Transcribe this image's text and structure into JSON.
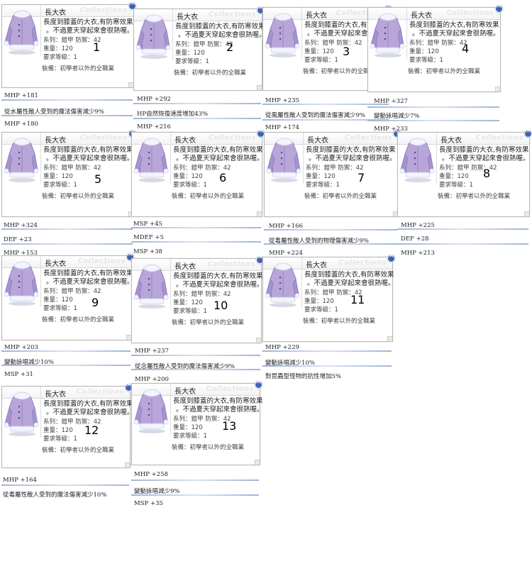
{
  "card_common": {
    "title": "長大衣",
    "watermark": "Collections",
    "desc_line1": "長度到膝蓋的大衣,有防寒效果",
    "desc_line2": "。不過夏天穿起來會很熱喔。",
    "series_line": "系列：鎧甲  防禦：42",
    "weight_line": "重量：120",
    "level_line": "要求等級：1",
    "equip_line": "裝備：初學者以外的全職業",
    "close_icon": "close-icon",
    "portrait_icon": "coat-icon"
  },
  "cards": [
    {
      "number": "1"
    },
    {
      "number": "2"
    },
    {
      "number": "3"
    },
    {
      "number": "4"
    },
    {
      "number": "5"
    },
    {
      "number": "6"
    },
    {
      "number": "7"
    },
    {
      "number": "8"
    },
    {
      "number": "9"
    },
    {
      "number": "10"
    },
    {
      "number": "11"
    },
    {
      "number": "12"
    },
    {
      "number": "13"
    }
  ],
  "bonuses": [
    {
      "text": "MHP +181"
    },
    {
      "text": "從水屬性敵人受到的魔法傷害減少9%"
    },
    {
      "text": "MHP +180"
    },
    {
      "text": "MHP +292"
    },
    {
      "text": "HP自然恢復速度增加43%"
    },
    {
      "text": "MHP +216"
    },
    {
      "text": "MHP +235"
    },
    {
      "text": "從風屬性敵人受到的魔法傷害減少9%"
    },
    {
      "text": "MHP +174"
    },
    {
      "text": "MHP +327"
    },
    {
      "text": "變動詠唱減少7%"
    },
    {
      "text": "MHP +233"
    },
    {
      "text": "MHP +324"
    },
    {
      "text": "DEF +23"
    },
    {
      "text": "MHP +153"
    },
    {
      "text": "MSP +45"
    },
    {
      "text": "MDEF +5"
    },
    {
      "text": "MSP +38"
    },
    {
      "text": "MHP +166"
    },
    {
      "text": "從毒屬性敵人受到的物理傷害減少9%"
    },
    {
      "text": "MHP +224"
    },
    {
      "text": "MHP +225"
    },
    {
      "text": "DEF +28"
    },
    {
      "text": "MHP +213"
    },
    {
      "text": "MHP +203"
    },
    {
      "text": "變動詠唱減少10%"
    },
    {
      "text": "MSP +31"
    },
    {
      "text": "MHP +237"
    },
    {
      "text": "從念屬性敵人受到的魔法傷害減少9%"
    },
    {
      "text": "MHP +200"
    },
    {
      "text": "MHP +229"
    },
    {
      "text": "變動詠唱減少10%"
    },
    {
      "text": "對昆蟲型怪物的抗性增加5%"
    },
    {
      "text": "MHP +164"
    },
    {
      "text": "從毒屬性敵人受到的魔法傷害減少10%"
    },
    {
      "text": "MHP +258"
    },
    {
      "text": "變動詠唱減少9%"
    },
    {
      "text": "MSP +35"
    }
  ],
  "colors": {
    "coat_body": "#b9a6d9",
    "coat_shade": "#8f7cc0",
    "coat_fur": "#f2f4ff",
    "window_border": "#b8b8b8",
    "close_button": "#3b63b5"
  }
}
